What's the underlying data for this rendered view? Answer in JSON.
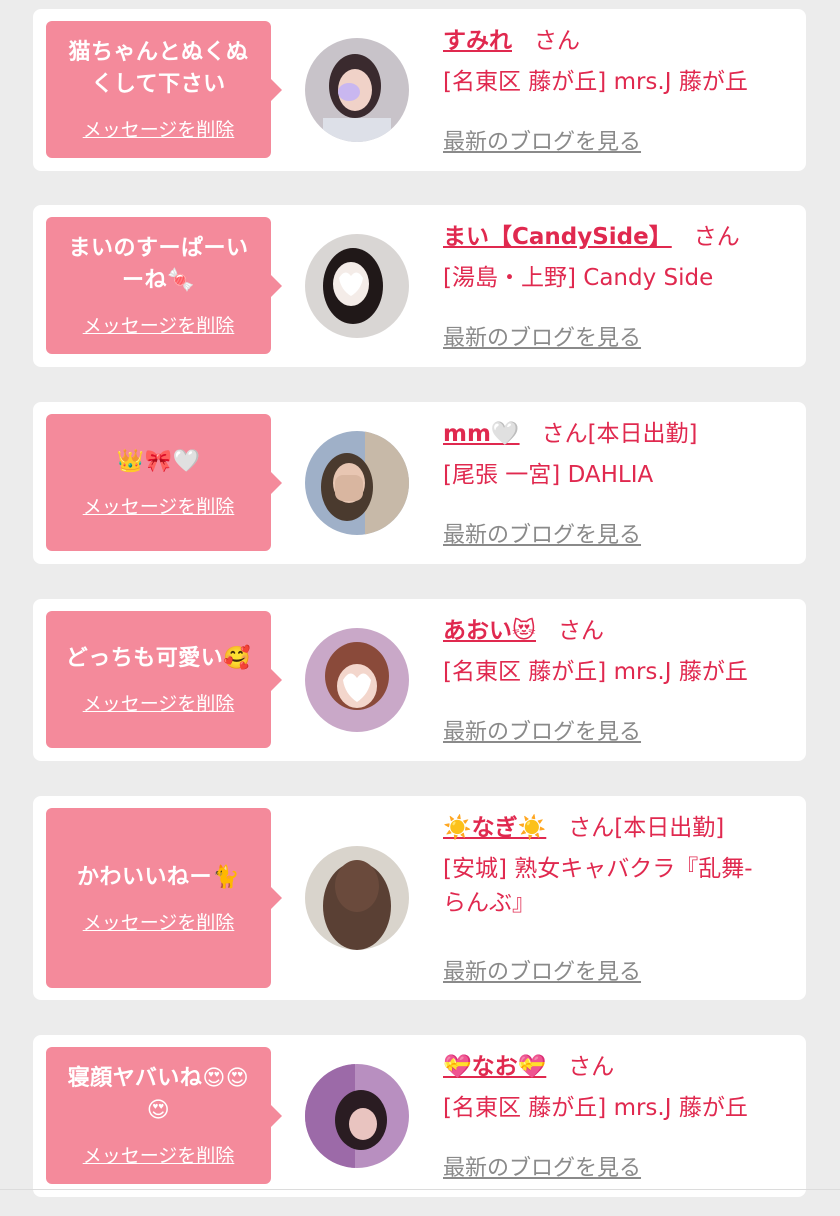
{
  "colors": {
    "accent": "#e0294f",
    "bubble": "#f48a9b",
    "background": "#ececec",
    "card": "#ffffff",
    "link_gray": "#8a8a8a"
  },
  "delete_label": "メッセージを削除",
  "blog_label": "最新のブログを見る",
  "cards": [
    {
      "message": "猫ちゃんとぬくぬくして下さい",
      "name": "すみれ",
      "suffix": "さん",
      "shop": "[名東区 藤が丘] mrs.J 藤が丘",
      "avatar_icon": "photo-avatar"
    },
    {
      "message": "まいのすーぱーいーね🍬",
      "name": "まい【CandySide】",
      "suffix": "さん",
      "shop": "[湯島・上野] Candy Side",
      "avatar_icon": "photo-avatar"
    },
    {
      "message": "👑🎀🤍",
      "name": "mm🤍",
      "suffix": "さん[本日出勤]",
      "shop": "[尾張 一宮] DAHLIA",
      "avatar_icon": "photo-avatar"
    },
    {
      "message": "どっちも可愛い🥰",
      "name": "あおい😻",
      "suffix": "さん",
      "shop": "[名東区 藤が丘] mrs.J 藤が丘",
      "avatar_icon": "photo-avatar"
    },
    {
      "message": "かわいいねー🐈",
      "name": "☀️なぎ☀️",
      "suffix": "さん[本日出勤]",
      "shop": "[安城] 熟女キャバクラ『乱舞-らんぶ』",
      "avatar_icon": "photo-avatar"
    },
    {
      "message": "寝顔ヤバいね😍😍😍",
      "name": "💝なお💝",
      "suffix": "さん",
      "shop": "[名東区 藤が丘] mrs.J 藤が丘",
      "avatar_icon": "photo-avatar"
    }
  ]
}
